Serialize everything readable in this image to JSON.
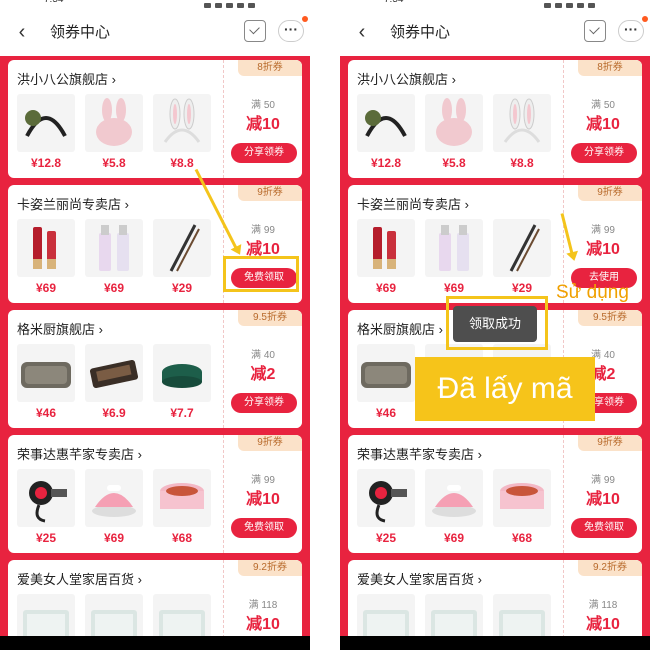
{
  "status_bar": {
    "time": "7:54"
  },
  "header": {
    "title": "领券中心"
  },
  "stores": [
    {
      "name": "洪小八公旗舰店",
      "discount_tag": "8折券",
      "condition": "满 50",
      "amount": "减10",
      "button": "分享领券",
      "products": [
        {
          "icon": "headband-icon",
          "price": "¥12.8"
        },
        {
          "icon": "bunny-plush-icon",
          "price": "¥5.8"
        },
        {
          "icon": "bunny-ears-icon",
          "price": "¥8.8"
        }
      ]
    },
    {
      "name": "卡姿兰丽尚专卖店",
      "discount_tag": "9折券",
      "condition": "满 99",
      "amount": "减10",
      "button": "免费领取",
      "button_after": "去使用",
      "products": [
        {
          "icon": "cosmetic-tube-icon",
          "price": "¥69"
        },
        {
          "icon": "serum-bottle-icon",
          "price": "¥69"
        },
        {
          "icon": "eyebrow-pencil-icon",
          "price": "¥29"
        }
      ]
    },
    {
      "name": "格米厨旗舰店",
      "discount_tag": "9.5折券",
      "condition": "满 40",
      "amount": "减2",
      "button": "分享领券",
      "products": [
        {
          "icon": "tray-icon",
          "price": "¥46"
        },
        {
          "icon": "soap-dish-icon",
          "price": "¥6.9"
        },
        {
          "icon": "bowl-icon",
          "price": "¥7.7"
        }
      ]
    },
    {
      "name": "荣事达惠芊家专卖店",
      "discount_tag": "9折券",
      "condition": "满 99",
      "amount": "减10",
      "button": "免费领取",
      "products": [
        {
          "icon": "massage-gun-icon",
          "price": "¥25"
        },
        {
          "icon": "iron-icon",
          "price": "¥69"
        },
        {
          "icon": "hot-pot-icon",
          "price": "¥68"
        }
      ]
    },
    {
      "name": "爱美女人堂家居百货",
      "discount_tag": "9.2折券",
      "condition": "满 118",
      "amount": "减10",
      "button": "",
      "products": [
        {
          "icon": "storage-box-icon",
          "price": ""
        },
        {
          "icon": "storage-box-icon",
          "price": ""
        },
        {
          "icon": "storage-box-icon",
          "price": ""
        }
      ]
    }
  ],
  "overlay": {
    "toast": "领取成功",
    "banner": "Đã lấy mã",
    "annotation": "Sử dụng"
  },
  "colors": {
    "primary": "#e8233f",
    "highlight": "#f4c41b",
    "tag_bg": "#fbe2c9"
  }
}
